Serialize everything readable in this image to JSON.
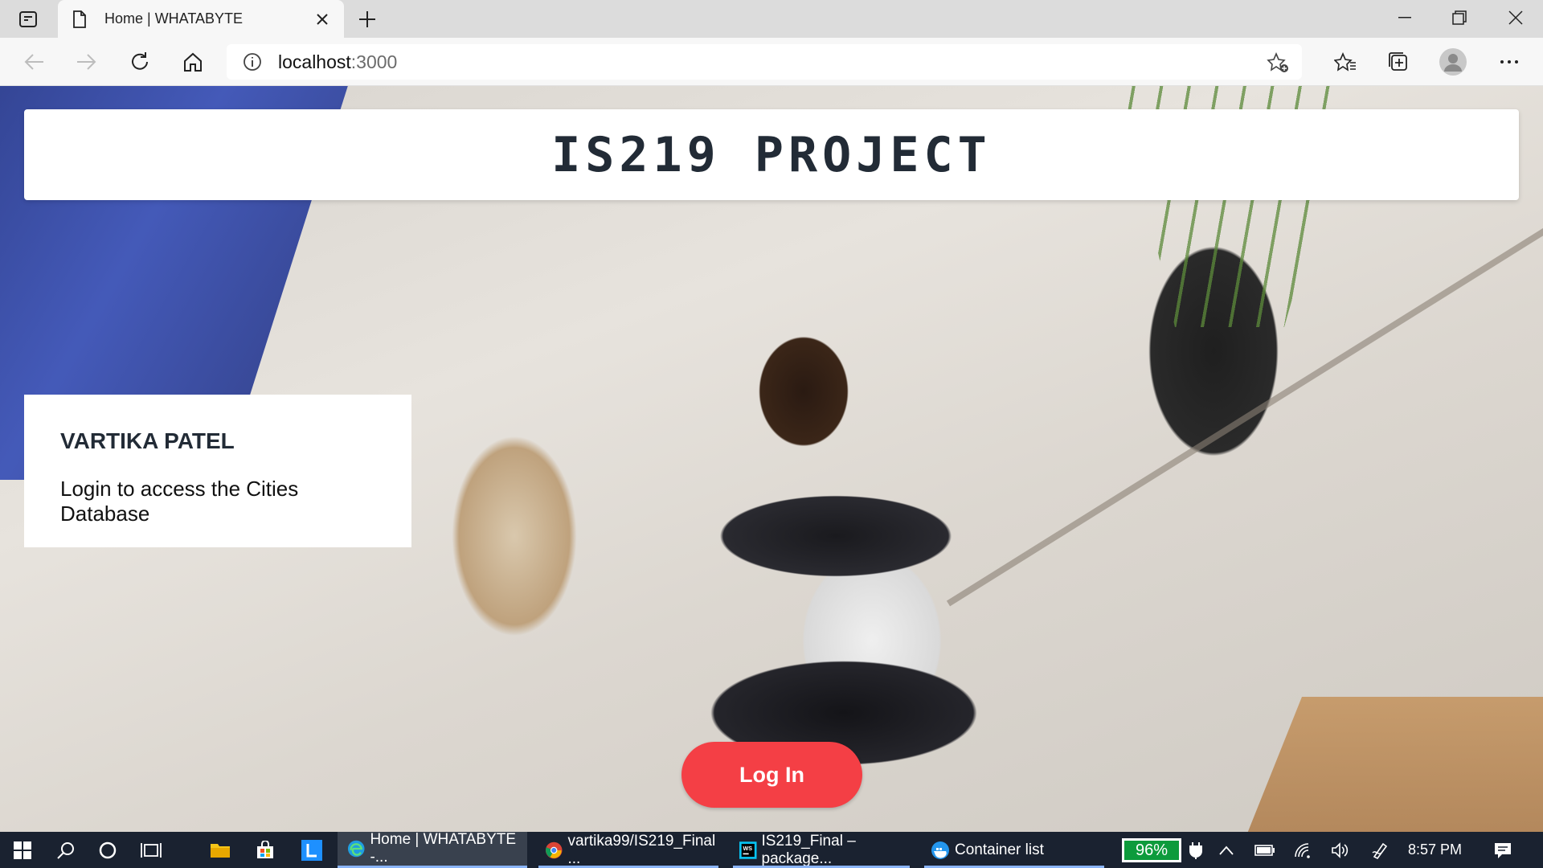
{
  "browser": {
    "tab_title": "Home | WHATABYTE",
    "url_host": "localhost",
    "url_port": ":3000"
  },
  "page": {
    "header_title": "IS219 PROJECT",
    "card_name": "VARTIKA PATEL",
    "card_description": "Login to access the Cities Database",
    "login_label": "Log In",
    "login_color": "#f43f45"
  },
  "taskbar": {
    "apps": [
      {
        "label": "Home | WHATABYTE -...",
        "icon": "edge-icon"
      },
      {
        "label": "vartika99/IS219_Final ...",
        "icon": "chrome-icon"
      },
      {
        "label": "IS219_Final – package...",
        "icon": "webstorm-icon"
      },
      {
        "label": "Container list",
        "icon": "docker-icon"
      }
    ],
    "battery": "96%",
    "time": "8:57 PM"
  }
}
